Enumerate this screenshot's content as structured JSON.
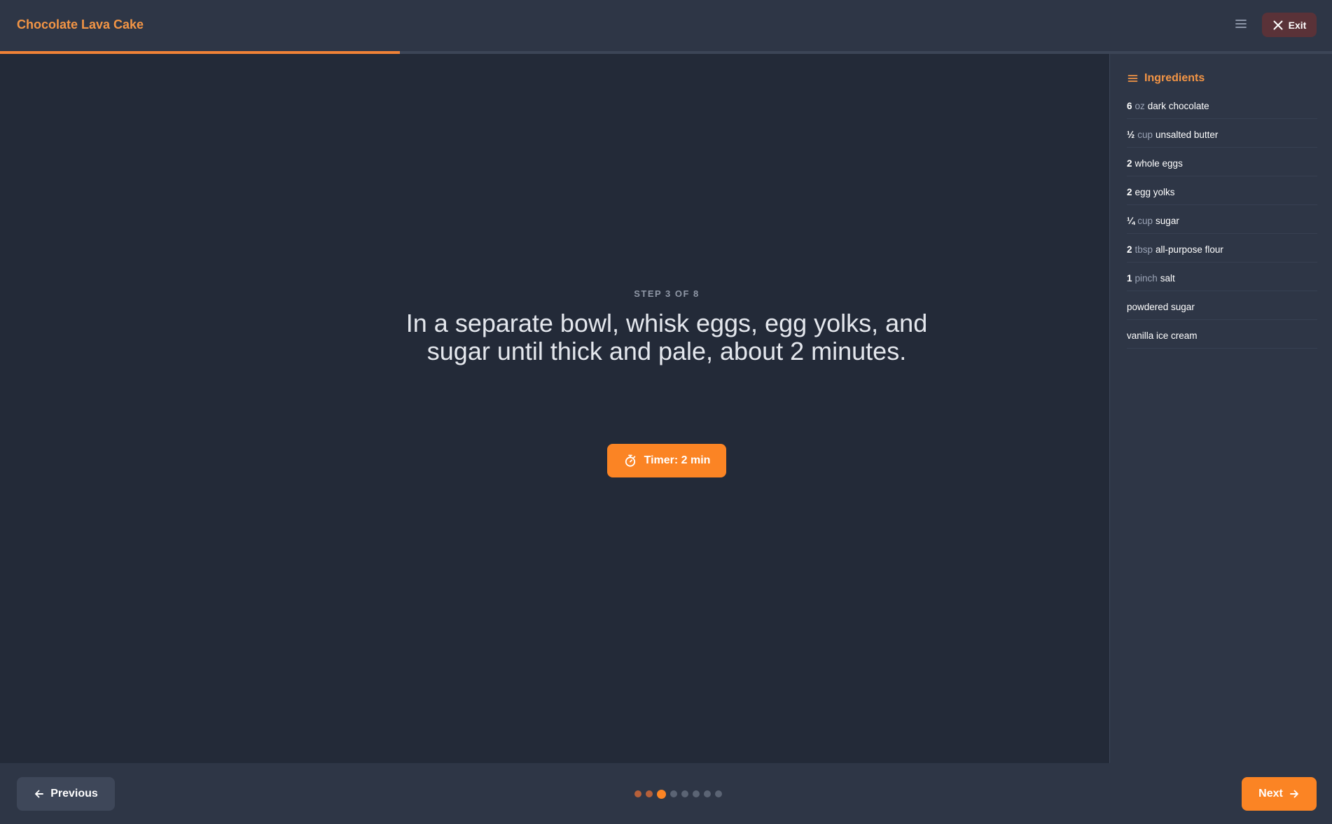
{
  "header": {
    "title": "Chocolate Lava Cake",
    "menu_icon": "hamburger-menu-icon",
    "exit_label": "Exit",
    "exit_icon": "close-icon"
  },
  "progress": {
    "fraction": 0.375
  },
  "step": {
    "label": "STEP 3 OF 8",
    "current": 3,
    "total": 8,
    "text": "In a separate bowl, whisk eggs, egg yolks, and sugar until thick and pale, about 2 minutes.",
    "timer_label": "Timer: 2 min",
    "timer_icon": "stopwatch-icon"
  },
  "ingredients": {
    "title": "Ingredients",
    "icon": "list-icon",
    "items": [
      {
        "qty": "6",
        "unit": "oz",
        "name": "dark chocolate"
      },
      {
        "qty": "½",
        "unit": "cup",
        "name": "unsalted butter"
      },
      {
        "qty": "2",
        "unit": "",
        "name": "whole eggs"
      },
      {
        "qty": "2",
        "unit": "",
        "name": "egg yolks"
      },
      {
        "qty": "¼",
        "unit": "cup",
        "name": "sugar"
      },
      {
        "qty": "2",
        "unit": "tbsp",
        "name": "all-purpose flour"
      },
      {
        "qty": "1",
        "unit": "pinch",
        "name": "salt"
      },
      {
        "qty": "",
        "unit": "",
        "name": "powdered sugar"
      },
      {
        "qty": "",
        "unit": "",
        "name": "vanilla ice cream"
      }
    ]
  },
  "footer": {
    "previous_label": "Previous",
    "previous_icon": "arrow-left-icon",
    "next_label": "Next",
    "next_icon": "arrow-right-icon"
  },
  "colors": {
    "accent": "#fb8424",
    "title_accent": "#f39545",
    "background": "#232a38",
    "panel": "#2e3646",
    "exit_bg": "#5a3238"
  }
}
